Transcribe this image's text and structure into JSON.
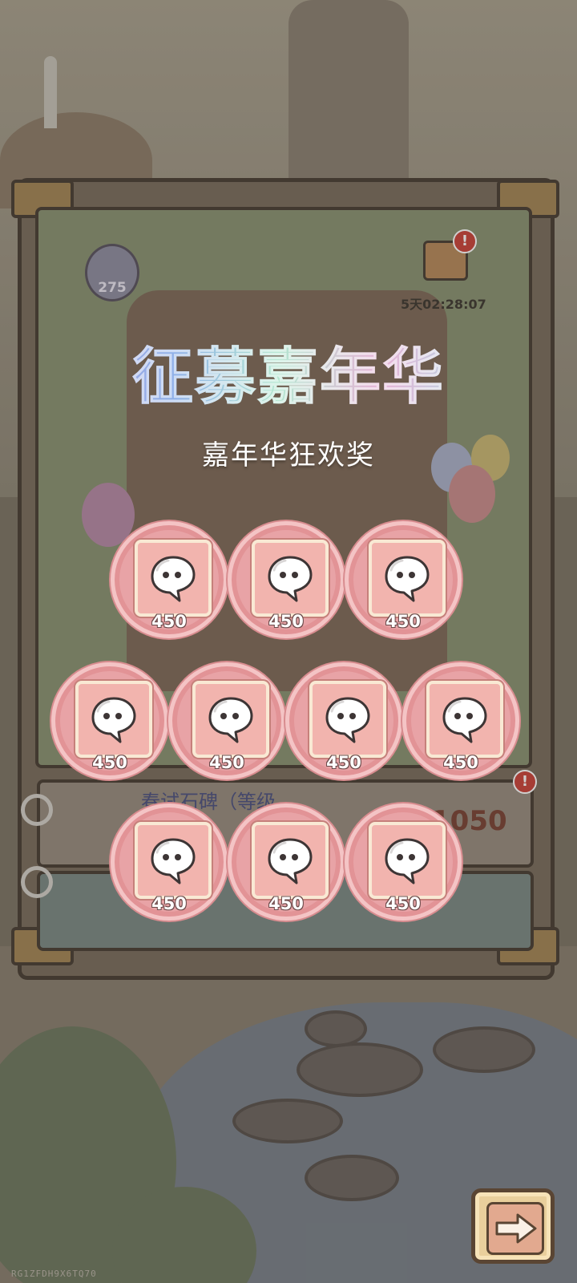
{
  "popup": {
    "title": "征募嘉年华",
    "subtitle": "嘉年华狂欢奖"
  },
  "rewards": [
    {
      "amount": "450",
      "icon": "ghost-token-icon"
    },
    {
      "amount": "450",
      "icon": "ghost-token-icon"
    },
    {
      "amount": "450",
      "icon": "ghost-token-icon"
    },
    {
      "amount": "450",
      "icon": "ghost-token-icon"
    },
    {
      "amount": "450",
      "icon": "ghost-token-icon"
    },
    {
      "amount": "450",
      "icon": "ghost-token-icon"
    },
    {
      "amount": "450",
      "icon": "ghost-token-icon"
    },
    {
      "amount": "450",
      "icon": "ghost-token-icon"
    },
    {
      "amount": "450",
      "icon": "ghost-token-icon"
    },
    {
      "amount": "450",
      "icon": "ghost-token-icon"
    }
  ],
  "background": {
    "score_badge": "275",
    "event_timer": "5天02:28:07",
    "quest_title": "春试石碑（等级",
    "quest_cost": "1050",
    "alert_mark": "!"
  },
  "continue_button": {
    "icon": "arrow-right-icon"
  },
  "watermark": "RG1ZFDH9X6TQ70",
  "colors": {
    "reward_ring": "#e8a3a6",
    "reward_tile": "#f2b4ae",
    "title_gradient": [
      "#b89ae0",
      "#b2e6d0",
      "#e7b2d6",
      "#a6e0e6"
    ]
  }
}
